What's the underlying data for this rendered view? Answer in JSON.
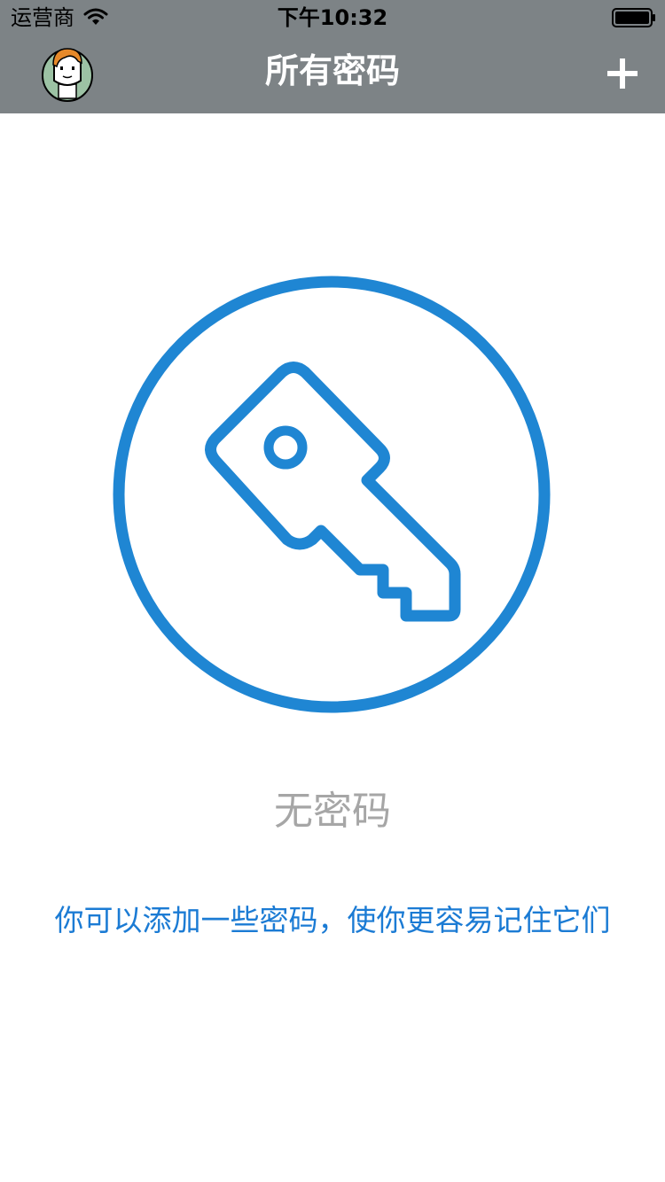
{
  "status_bar": {
    "carrier": "运营商",
    "time": "下午10:32",
    "wifi_icon": "wifi-icon",
    "battery_icon": "battery-icon"
  },
  "nav": {
    "title": "所有密码",
    "avatar_icon": "avatar-icon",
    "add_icon": "plus-icon"
  },
  "empty_state": {
    "icon": "key-icon",
    "title": "无密码",
    "hint": "你可以添加一些密码，使你更容易记住它们"
  },
  "colors": {
    "nav_background": "#7d8386",
    "accent": "#1b7bd4",
    "key_blue": "#1f86d3",
    "muted_text": "#a6a6a6"
  }
}
